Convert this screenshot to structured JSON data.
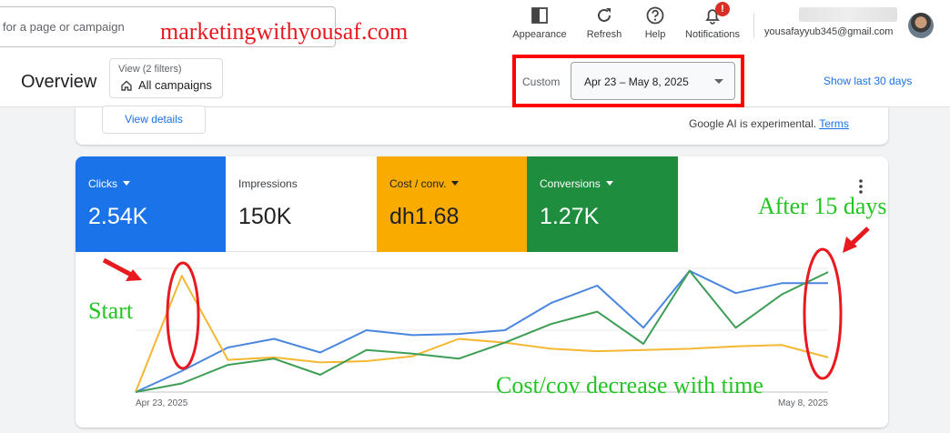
{
  "search": {
    "placeholder": "for a page or campaign"
  },
  "watermark": "marketingwithyousaf.com",
  "toolbar": {
    "appearance": "Appearance",
    "refresh": "Refresh",
    "help": "Help",
    "notifications": "Notifications",
    "notification_count": "!"
  },
  "account": {
    "email": "yousafayyub345@gmail.com"
  },
  "header": {
    "title": "Overview",
    "filter_label": "View (2 filters)",
    "filter_value": "All campaigns",
    "date_type": "Custom",
    "date_range": "Apr 23 – May 8, 2025",
    "show_last": "Show last 30 days"
  },
  "insight_card": {
    "view_details": "View details",
    "ai_note": "Google AI is experimental.",
    "terms": "Terms"
  },
  "metrics": [
    {
      "label": "Clicks",
      "value": "2.54K",
      "color": "#1a73e8",
      "dropdown": true
    },
    {
      "label": "Impressions",
      "value": "150K",
      "color": "#ffffff",
      "dropdown": false
    },
    {
      "label": "Cost / conv.",
      "value": "dh1.68",
      "color": "#f9ab00",
      "dropdown": true
    },
    {
      "label": "Conversions",
      "value": "1.27K",
      "color": "#1e8e3e",
      "dropdown": true
    }
  ],
  "chart_data": {
    "type": "line",
    "x": [
      "Apr 23",
      "Apr 24",
      "Apr 25",
      "Apr 26",
      "Apr 27",
      "Apr 28",
      "Apr 29",
      "Apr 30",
      "May 1",
      "May 2",
      "May 3",
      "May 4",
      "May 5",
      "May 6",
      "May 7",
      "May 8"
    ],
    "x_tick_labels": [
      "Apr 23, 2025",
      "May 8, 2025"
    ],
    "ylim": [
      0,
      100
    ],
    "grid": true,
    "legend": "none",
    "series": [
      {
        "key": "clicks",
        "color": "#4a86e0",
        "values": [
          0,
          17,
          36,
          43,
          32,
          50,
          46,
          47,
          50,
          72,
          86,
          52,
          98,
          80,
          88,
          88
        ]
      },
      {
        "key": "cost_per_conv",
        "color": "#f5b731",
        "values": [
          0,
          94,
          26,
          28,
          24,
          25,
          29,
          43,
          40,
          35,
          33,
          34,
          35,
          37,
          38,
          28
        ]
      },
      {
        "key": "conversions",
        "color": "#3e9e56",
        "values": [
          0,
          7,
          22,
          27,
          14,
          34,
          31,
          27,
          40,
          55,
          65,
          39,
          98,
          52,
          79,
          97
        ]
      }
    ]
  },
  "annotations": {
    "after": "After 15 days",
    "start": "Start",
    "cost": "Cost/cov decrease with time"
  }
}
